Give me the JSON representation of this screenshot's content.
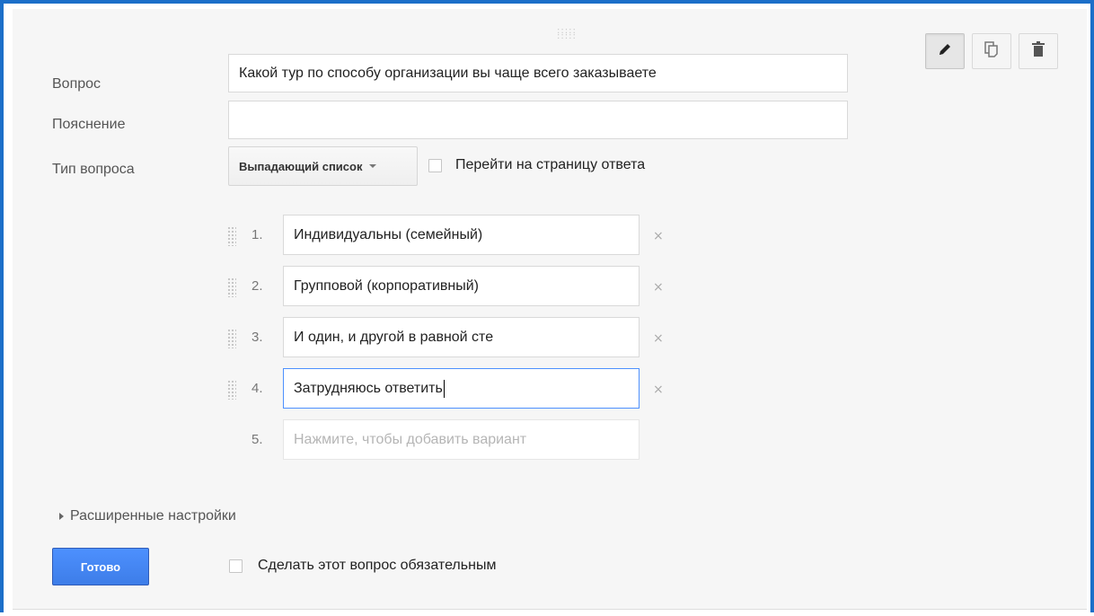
{
  "question": {
    "label": "Вопрос",
    "value": "Какой тур по способу организации вы чаще всего заказываете"
  },
  "help_text": {
    "label": "Пояснение",
    "value": ""
  },
  "question_type": {
    "label": "Тип вопроса",
    "selected": "Выпадающий список",
    "go_to_page_label": "Перейти на страницу ответа",
    "go_to_page_checked": false
  },
  "options": [
    {
      "number": "1.",
      "value": "Индивидуальны (семейный)"
    },
    {
      "number": "2.",
      "value": "Групповой (корпоративный)"
    },
    {
      "number": "3.",
      "value": "И один, и другой в равной сте"
    },
    {
      "number": "4.",
      "value": "Затрудняюсь ответить"
    }
  ],
  "add_option": {
    "number": "5.",
    "placeholder": "Нажмите, чтобы добавить вариант"
  },
  "remove_glyph": "×",
  "advanced_settings_label": "Расширенные настройки",
  "done_label": "Готово",
  "required_label": "Сделать этот вопрос обязательным",
  "required_checked": false,
  "toolbar": {
    "icons": [
      "pencil-icon",
      "copy-icon",
      "trash-icon"
    ]
  },
  "colors": {
    "frame_accent": "#1c6fc9",
    "done_button": "#4d90fe",
    "focus_border": "#4d90fe"
  }
}
